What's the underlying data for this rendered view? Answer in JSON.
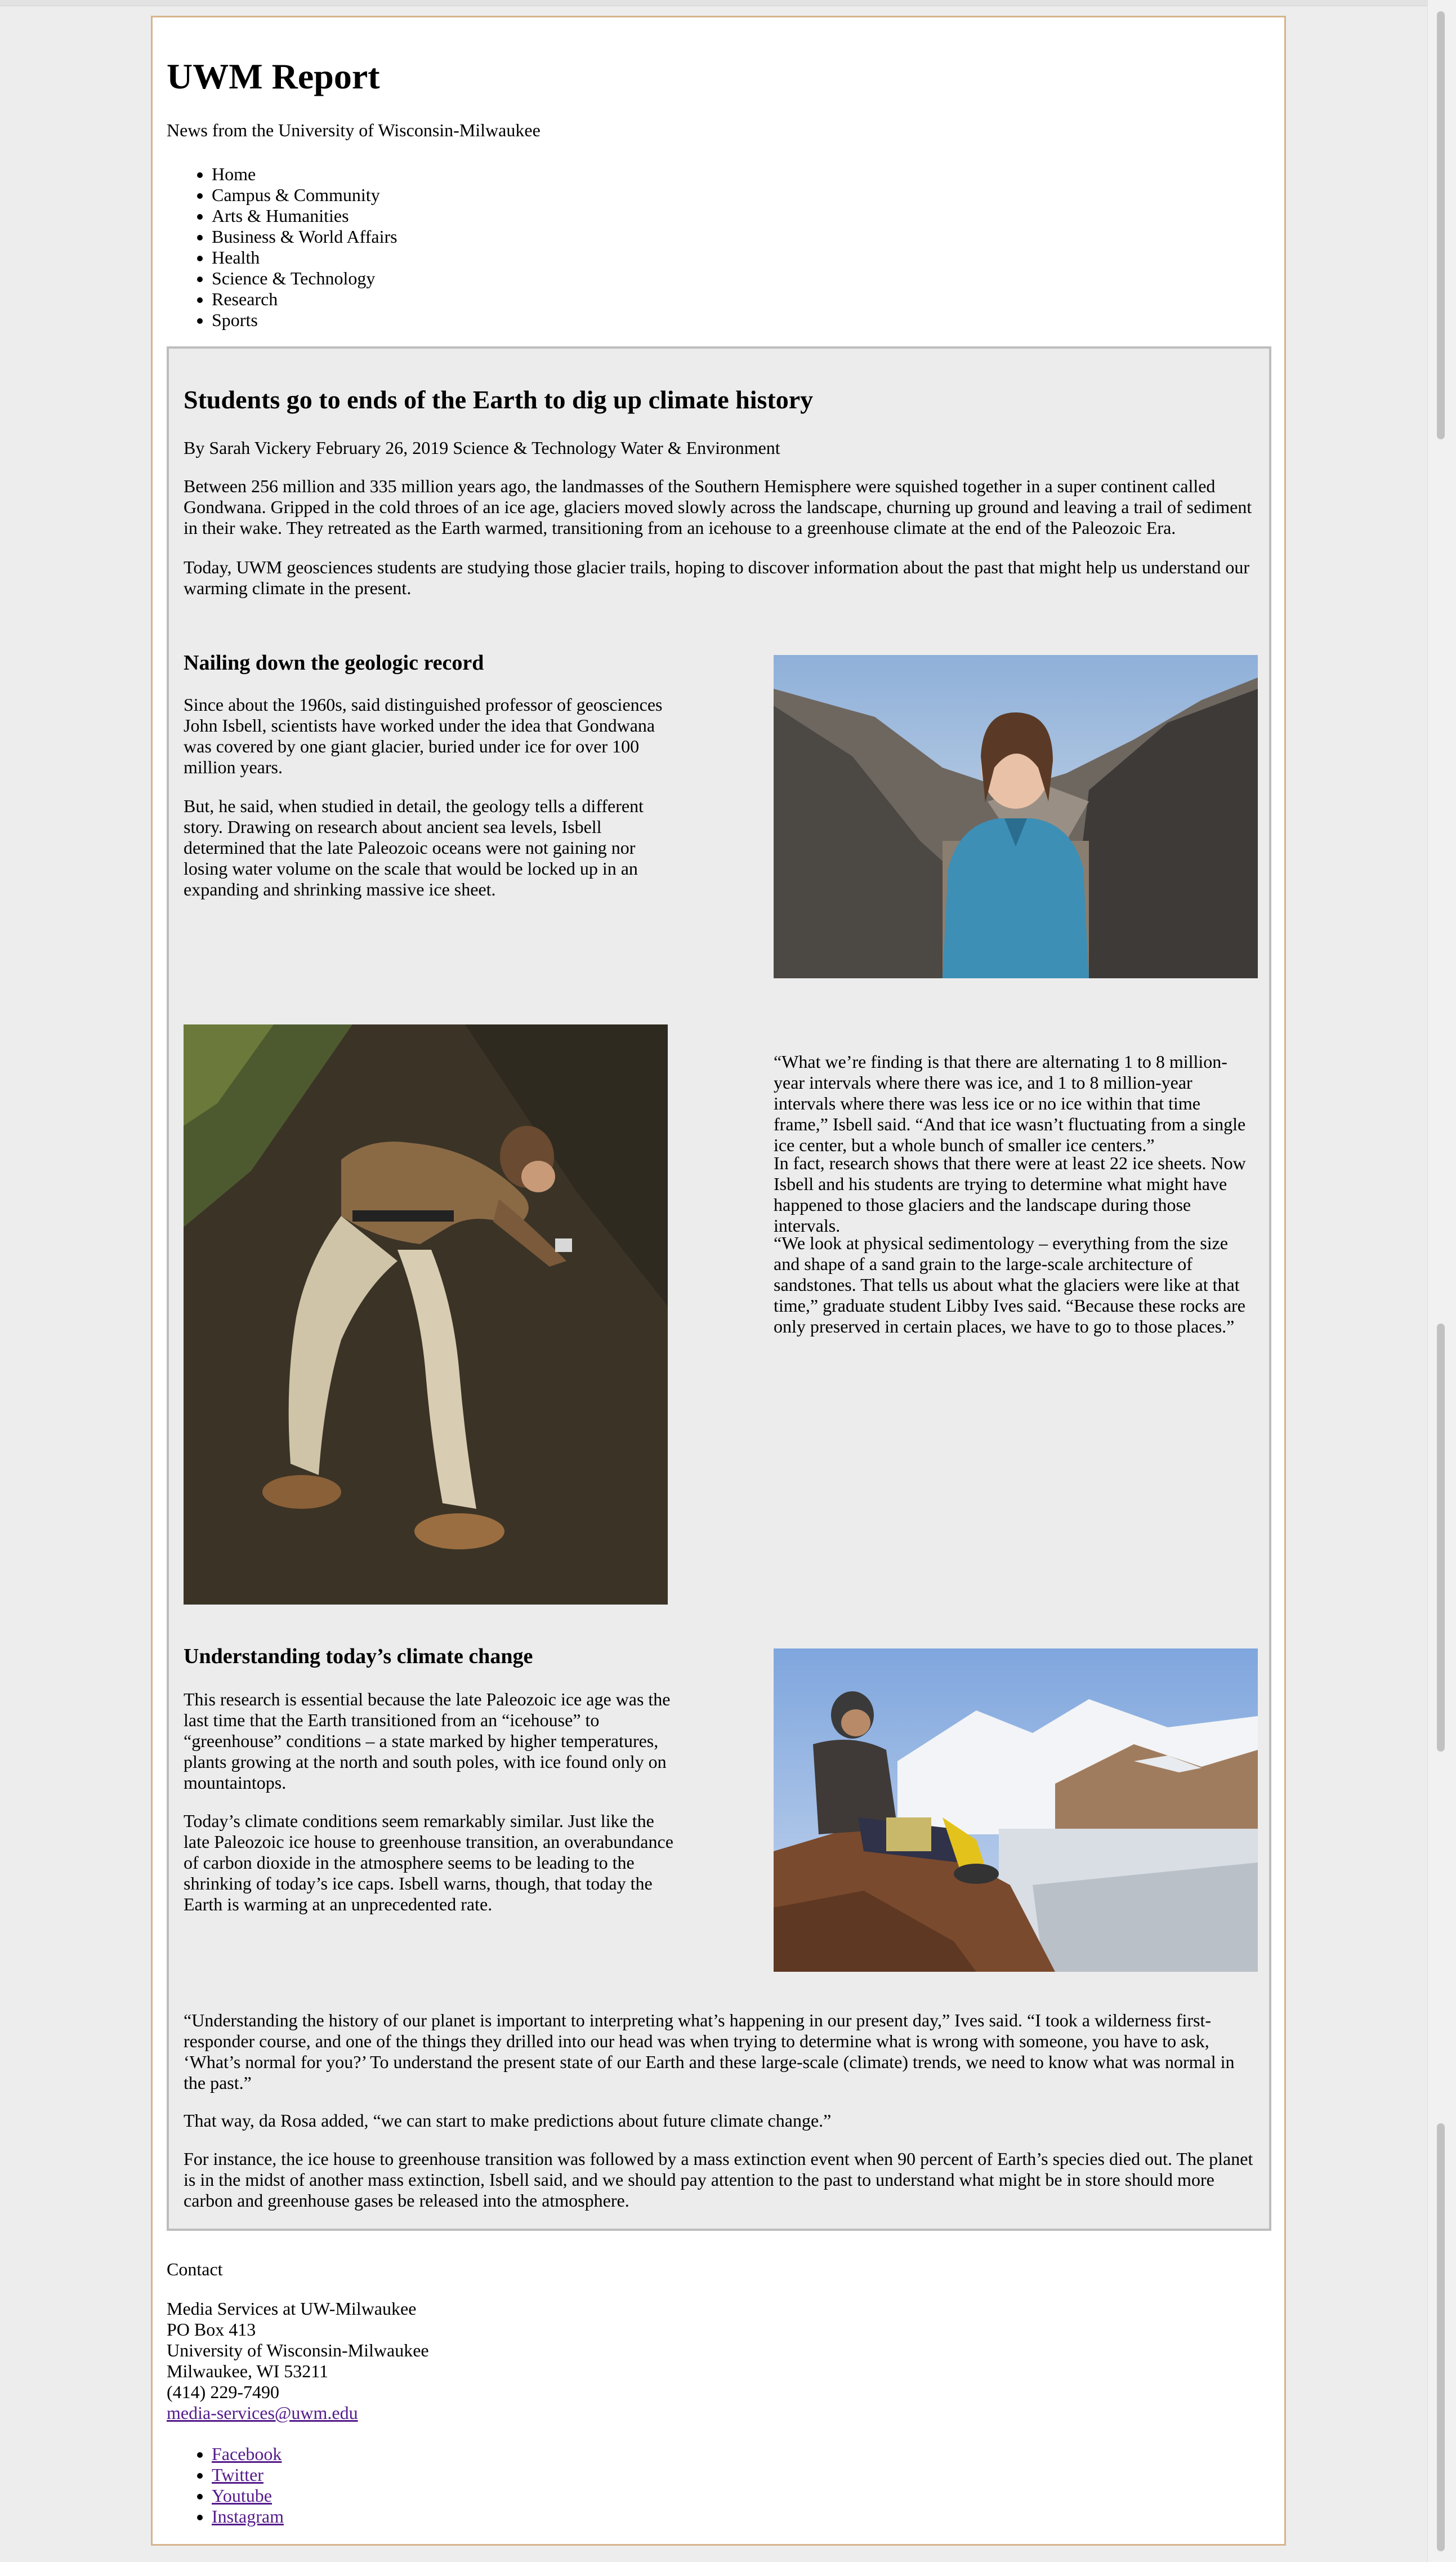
{
  "site": {
    "title": "UWM Report",
    "tagline": "News from the University of Wisconsin-Milwaukee"
  },
  "nav": [
    "Home",
    "Campus & Community",
    "Arts & Humanities",
    "Business & World Affairs",
    "Health",
    "Science & Technology",
    "Research",
    "Sports"
  ],
  "article": {
    "headline": "Students go to ends of the Earth to dig up climate history",
    "byline": "By Sarah Vickery February 26, 2019 Science & Technology Water & Environment",
    "intro1": "Between 256 million and 335 million years ago, the landmasses of the Southern Hemisphere were squished together in a super continent called Gondwana. Gripped in the cold throes of an ice age, glaciers moved slowly across the landscape, churning up ground and leaving a trail of sediment in their wake. They retreated as the Earth warmed, transitioning from an icehouse to a greenhouse climate at the end of the Paleozoic Era.",
    "intro2": "Today, UWM geosciences students are studying those glacier trails, hoping to discover information about the past that might help us understand our warming climate in the present.",
    "section1_title": "Nailing down the geologic record",
    "s1p1": "Since about the 1960s, said distinguished professor of geosciences John Isbell, scientists have worked under the idea that Gondwana was covered by one giant glacier, buried under ice for over 100 million years.",
    "s1p2": "But, he said, when studied in detail, the geology tells a different story. Drawing on research about ancient sea levels, Isbell determined that the late Paleozoic oceans were not gaining nor losing water volume on the scale that would be locked up in an expanding and shrinking massive ice sheet.",
    "q1": "“What we’re finding is that there are alternating 1 to 8 million-year intervals where there was ice, and 1 to 8 million-year intervals where there was less ice or no ice within that time frame,” Isbell said. “And that ice wasn’t fluctuating from a single ice center, but a whole bunch of smaller ice centers.”",
    "q2": "In fact, research shows that there were at least 22 ice sheets. Now Isbell and his students are trying to determine what might have happened to those glaciers and the landscape during those intervals.",
    "q3": "“We look at physical sedimentology – everything from the size and shape of a sand grain to the large-scale architecture of sandstones. That tells us about what the glaciers were like at that time,” graduate student Libby Ives said. “Because these rocks are only preserved in certain places, we have to go to those places.”",
    "section2_title": "Understanding today’s climate change",
    "s2p1": "This research is essential because the late Paleozoic ice age was the last time that the Earth transitioned from an “icehouse” to “greenhouse” conditions – a state marked by higher temperatures, plants growing at the north and south poles, with ice found only on mountaintops.",
    "s2p2": "Today’s climate conditions seem remarkably similar. Just like the late Paleozoic ice house to greenhouse transition, an overabundance of carbon dioxide in the atmosphere seems to be leading to the shrinking of today’s ice caps. Isbell warns, though, that today the Earth is warming at an unprecedented rate.",
    "c1": "“Understanding the history of our planet is important to interpreting what’s happening in our present day,” Ives said. “I took a wilderness first-responder course, and one of the things they drilled into our head was when trying to determine what is wrong with someone, you have to ask, ‘What’s normal for you?’ To understand the present state of our Earth and these large-scale (climate) trends, we need to know what was normal in the past.”",
    "c2": "That way, da Rosa added, “we can start to make predictions about future climate change.”",
    "c3": "For instance, the ice house to greenhouse transition was followed by a mass extinction event when 90 percent of Earth’s species died out. The planet is in the midst of another mass extinction, Isbell said, and we should pay attention to the past to understand what might be in store should more carbon and greenhouse gases be released into the atmosphere."
  },
  "footer": {
    "contact_label": "Contact",
    "org": "Media Services at UW-Milwaukee",
    "pobox": "PO Box 413",
    "university": "University of Wisconsin-Milwaukee",
    "city": "Milwaukee, WI 53211",
    "phone": "(414) 229-7490",
    "email": "media-services@uwm.edu",
    "social": [
      "Facebook",
      "Twitter",
      "Youtube",
      "Instagram"
    ]
  }
}
